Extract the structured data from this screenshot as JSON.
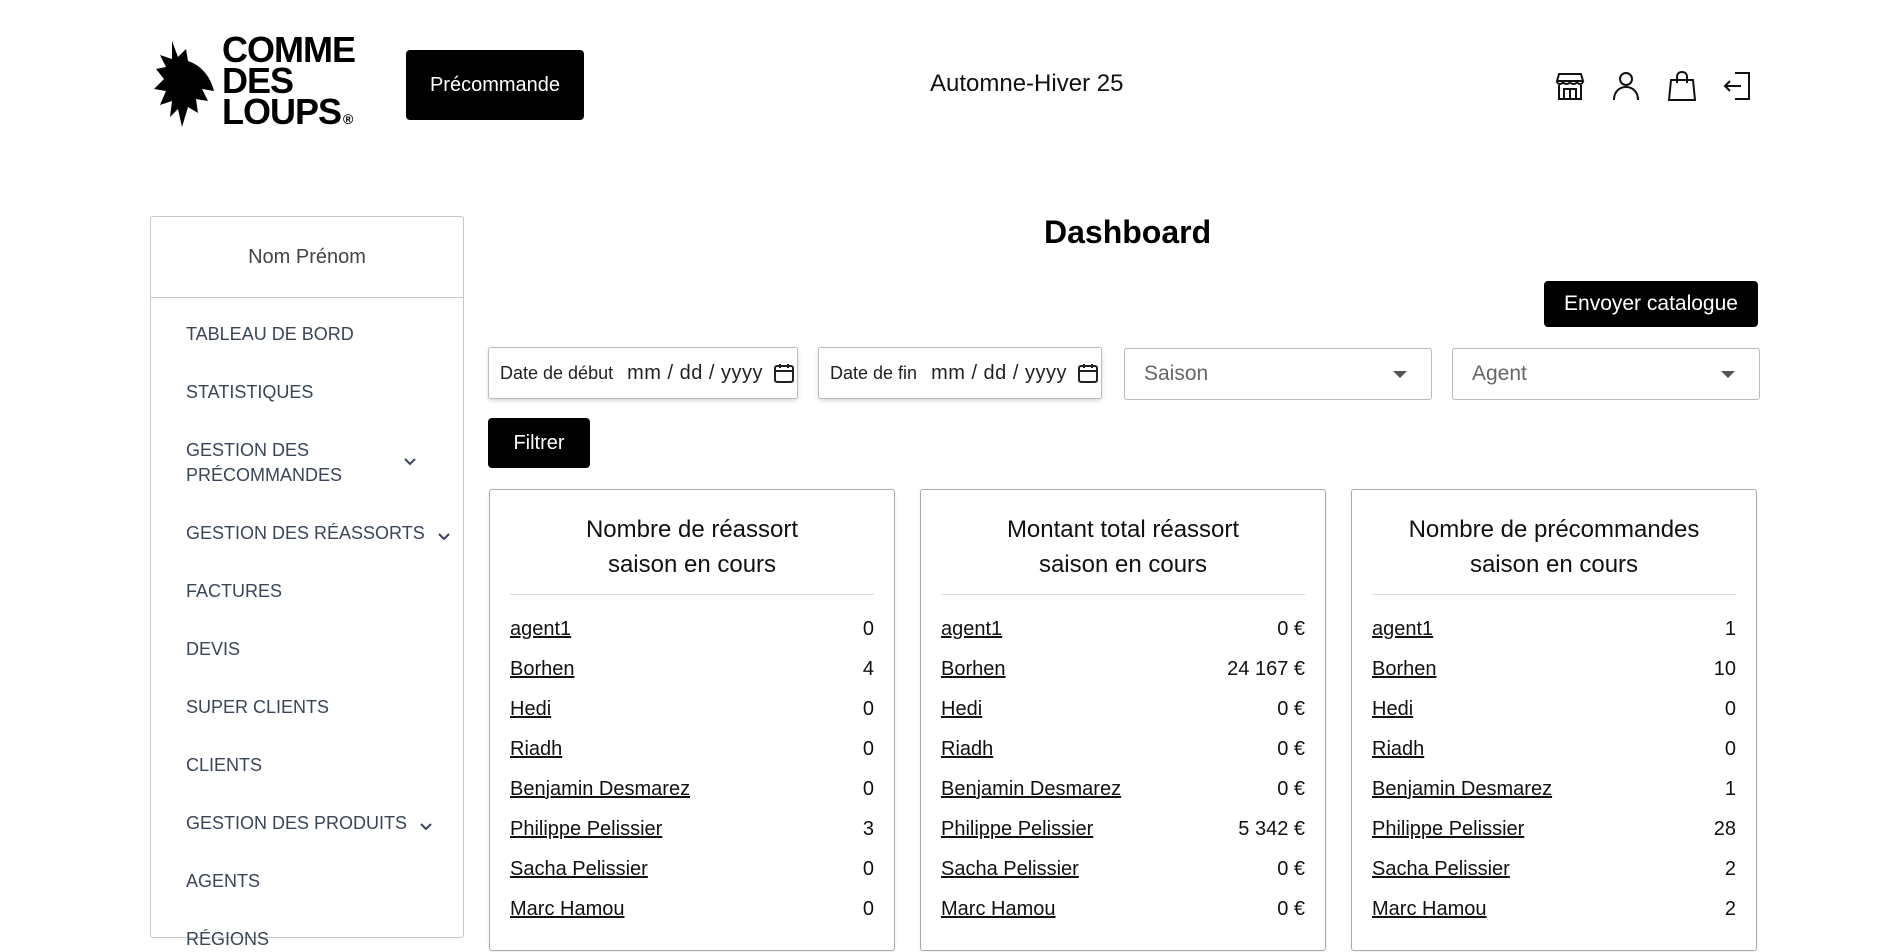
{
  "header": {
    "logo_text_line1": "COMME",
    "logo_text_line2": "DES",
    "logo_text_line3": "LOUPS",
    "logo_reg": "®",
    "precommande_label": "Précommande",
    "season": "Automne-Hiver 25",
    "icons": [
      "store-icon",
      "user-icon",
      "shopping-bag-icon",
      "logout-icon"
    ]
  },
  "sidebar": {
    "user_name": "Nom Prénom",
    "items": [
      {
        "label": "TABLEAU DE BORD",
        "has_chevron": false
      },
      {
        "label": "STATISTIQUES",
        "has_chevron": false
      },
      {
        "label": "GESTION DES PRÉCOMMANDES",
        "has_chevron": true
      },
      {
        "label": "GESTION DES RÉASSORTS",
        "has_chevron": true
      },
      {
        "label": "FACTURES",
        "has_chevron": false
      },
      {
        "label": "DEVIS",
        "has_chevron": false
      },
      {
        "label": "SUPER CLIENTS",
        "has_chevron": false
      },
      {
        "label": "CLIENTS",
        "has_chevron": false
      },
      {
        "label": "GESTION DES PRODUITS",
        "has_chevron": true
      },
      {
        "label": "AGENTS",
        "has_chevron": false
      },
      {
        "label": "RÉGIONS",
        "has_chevron": false
      }
    ]
  },
  "main": {
    "title": "Dashboard",
    "send_catalog_label": "Envoyer catalogue",
    "filters": {
      "start_label": "Date de début",
      "start_value": "mm / dd / yyyy",
      "end_label": "Date de fin",
      "end_value": "mm / dd / yyyy",
      "season_placeholder": "Saison",
      "agent_placeholder": "Agent",
      "filter_label": "Filtrer"
    },
    "cards": [
      {
        "title_line1": "Nombre de réassort",
        "title_line2": "saison en cours",
        "rows": [
          {
            "name": "agent1",
            "value": "0"
          },
          {
            "name": "Borhen",
            "value": "4"
          },
          {
            "name": "Hedi",
            "value": "0"
          },
          {
            "name": "Riadh",
            "value": "0"
          },
          {
            "name": "Benjamin Desmarez",
            "value": "0"
          },
          {
            "name": "Philippe Pelissier",
            "value": "3"
          },
          {
            "name": "Sacha Pelissier",
            "value": "0"
          },
          {
            "name": "Marc Hamou",
            "value": "0"
          }
        ]
      },
      {
        "title_line1": "Montant total réassort",
        "title_line2": "saison en cours",
        "rows": [
          {
            "name": "agent1",
            "value": "0 €"
          },
          {
            "name": "Borhen",
            "value": "24 167 €"
          },
          {
            "name": "Hedi",
            "value": "0 €"
          },
          {
            "name": "Riadh",
            "value": "0 €"
          },
          {
            "name": "Benjamin Desmarez",
            "value": "0 €"
          },
          {
            "name": "Philippe Pelissier",
            "value": "5 342 €"
          },
          {
            "name": "Sacha Pelissier",
            "value": "0 €"
          },
          {
            "name": "Marc Hamou",
            "value": "0 €"
          }
        ]
      },
      {
        "title_line1": "Nombre de précommandes",
        "title_line2": "saison en cours",
        "rows": [
          {
            "name": "agent1",
            "value": "1"
          },
          {
            "name": "Borhen",
            "value": "10"
          },
          {
            "name": "Hedi",
            "value": "0"
          },
          {
            "name": "Riadh",
            "value": "0"
          },
          {
            "name": "Benjamin Desmarez",
            "value": "1"
          },
          {
            "name": "Philippe Pelissier",
            "value": "28"
          },
          {
            "name": "Sacha Pelissier",
            "value": "2"
          },
          {
            "name": "Marc Hamou",
            "value": "2"
          }
        ]
      }
    ]
  }
}
